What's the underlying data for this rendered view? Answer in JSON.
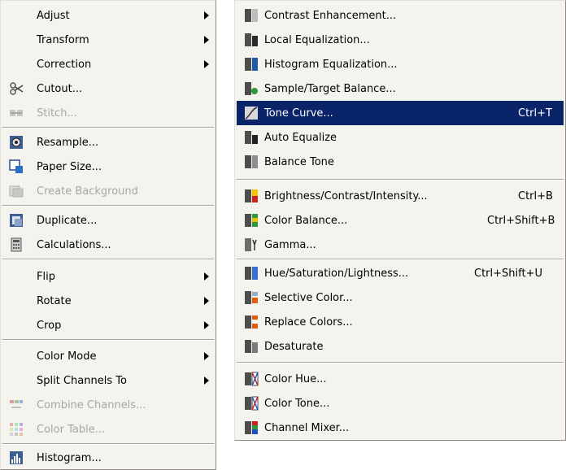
{
  "left_menu": {
    "items": [
      {
        "label": "Adjust",
        "submenu": true
      },
      {
        "label": "Transform",
        "submenu": true
      },
      {
        "label": "Correction",
        "submenu": true
      },
      {
        "label": "Cutout...",
        "icon": "scissors-icon"
      },
      {
        "label": "Stitch...",
        "icon": "stitch-icon",
        "disabled": true
      },
      {
        "label": "Resample...",
        "icon": "resample-icon"
      },
      {
        "label": "Paper Size...",
        "icon": "paper-size-icon"
      },
      {
        "label": "Create Background",
        "icon": "create-background-icon",
        "disabled": true
      },
      {
        "label": "Duplicate...",
        "icon": "duplicate-icon"
      },
      {
        "label": "Calculations...",
        "icon": "calculator-icon"
      },
      {
        "label": "Flip",
        "submenu": true
      },
      {
        "label": "Rotate",
        "submenu": true
      },
      {
        "label": "Crop",
        "submenu": true
      },
      {
        "label": "Color Mode",
        "submenu": true
      },
      {
        "label": "Split Channels To",
        "submenu": true
      },
      {
        "label": "Combine Channels...",
        "icon": "combine-channels-icon",
        "disabled": true
      },
      {
        "label": "Color Table...",
        "icon": "color-table-icon",
        "disabled": true
      },
      {
        "label": "Histogram...",
        "icon": "histogram-icon"
      }
    ]
  },
  "right_menu": {
    "items": [
      {
        "label": "Contrast Enhancement...",
        "icon": "contrast-enhancement-icon"
      },
      {
        "label": "Local Equalization...",
        "icon": "local-equalization-icon"
      },
      {
        "label": "Histogram Equalization...",
        "icon": "histogram-equalization-icon"
      },
      {
        "label": "Sample/Target Balance...",
        "icon": "sample-target-balance-icon"
      },
      {
        "label": "Tone Curve...",
        "shortcut": "Ctrl+T",
        "icon": "tone-curve-icon",
        "highlighted": true
      },
      {
        "label": "Auto Equalize",
        "icon": "auto-equalize-icon"
      },
      {
        "label": "Balance Tone",
        "icon": "balance-tone-icon"
      },
      {
        "label": "Brightness/Contrast/Intensity...",
        "shortcut": "Ctrl+B",
        "icon": "brightness-contrast-icon"
      },
      {
        "label": "Color Balance...",
        "shortcut": "Ctrl+Shift+B",
        "icon": "color-balance-icon"
      },
      {
        "label": "Gamma...",
        "icon": "gamma-icon"
      },
      {
        "label": "Hue/Saturation/Lightness...",
        "shortcut": "Ctrl+Shift+U",
        "icon": "hue-saturation-icon"
      },
      {
        "label": "Selective Color...",
        "icon": "selective-color-icon"
      },
      {
        "label": "Replace Colors...",
        "icon": "replace-colors-icon"
      },
      {
        "label": "Desaturate",
        "icon": "desaturate-icon"
      },
      {
        "label": "Color Hue...",
        "icon": "color-hue-icon"
      },
      {
        "label": "Color Tone...",
        "icon": "color-tone-icon"
      },
      {
        "label": "Channel Mixer...",
        "icon": "channel-mixer-icon"
      }
    ]
  },
  "colors": {
    "menu_bg": "#f4f3ee",
    "highlight": "#0a246a",
    "disabled_text": "#a7a6a0"
  }
}
